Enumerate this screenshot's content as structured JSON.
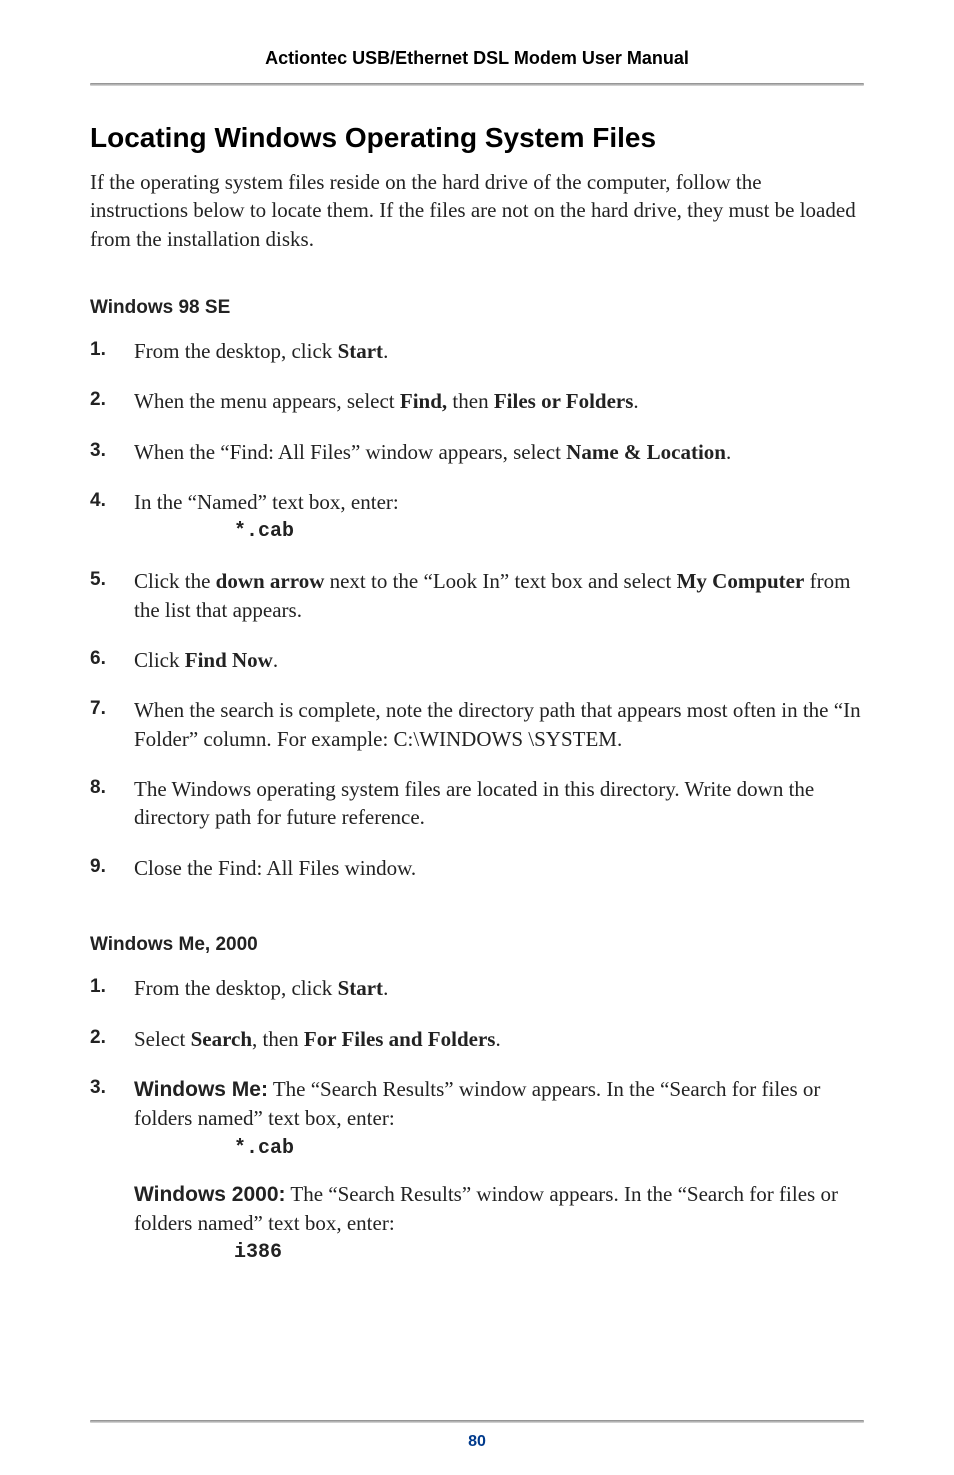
{
  "header": {
    "title": "Actiontec USB/Ethernet DSL Modem User Manual"
  },
  "section": {
    "title": "Locating Windows Operating System Files",
    "intro": "If the operating system files reside on the hard drive of the computer, follow the instructions below to locate them. If the files are not on the hard drive, they must be loaded from the installation disks."
  },
  "win98": {
    "heading": "Windows 98 SE",
    "steps": {
      "n1": "1.",
      "s1a": "From the desktop, click ",
      "s1b": "Start",
      "s1c": ".",
      "n2": "2.",
      "s2a": "When the menu appears, select ",
      "s2b": "Find,",
      "s2c": " then ",
      "s2d": "Files or Folders",
      "s2e": ".",
      "n3": "3.",
      "s3a": "When the “Find: All Files” window appears, select ",
      "s3b": "Name & Location",
      "s3c": ".",
      "n4": "4.",
      "s4a": "In the “Named” text box, enter:",
      "s4code": "*.cab",
      "n5": "5.",
      "s5a": "Click the ",
      "s5b": "down arrow",
      "s5c": " next to the “Look In” text box and select ",
      "s5d": "My Computer",
      "s5e": " from the list that appears.",
      "n6": "6.",
      "s6a": "Click ",
      "s6b": "Find Now",
      "s6c": ".",
      "n7": "7.",
      "s7a": " When the search is complete, note the directory path that appears most often in the “In Folder” column. For example: ",
      "s7path": "C:\\WINDOWS \\SYSTEM",
      "s7b": ".",
      "n8": "8.",
      "s8a": "The Windows operating system files are located in this directory. Write down the directory path for future reference.",
      "n9": "9.",
      "s9a": " Close the Find: All Files window."
    }
  },
  "winme": {
    "heading": "Windows Me, 2000",
    "steps": {
      "n1": "1.",
      "s1a": "From the desktop, click ",
      "s1b": "Start",
      "s1c": ".",
      "n2": "2.",
      "s2a": "Select ",
      "s2b": "Search",
      "s2c": ", then ",
      "s2d": "For Files and Folders",
      "s2e": ".",
      "n3": "3.",
      "s3lead1": "Windows Me:",
      "s3a": " The “Search Results” window appears. In the “Search for files or folders named” text box, enter:",
      "s3code1": "*.cab",
      "s3lead2": "Windows 2000:",
      "s3b": " The “Search Results” window appears. In the “Search for files or folders named” text box, enter:",
      "s3code2": "i386"
    }
  },
  "footer": {
    "pagenum": "80"
  }
}
